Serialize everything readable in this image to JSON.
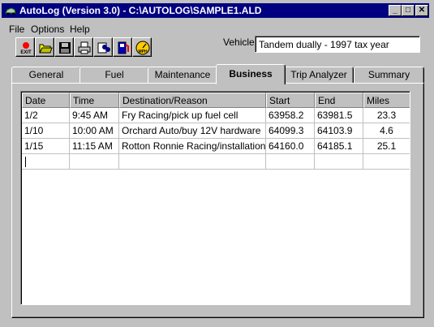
{
  "window": {
    "title": "AutoLog (Version 3.0) - C:\\AUTOLOG\\SAMPLE1.ALD",
    "minimize": "_",
    "maximize": "□",
    "close": "✕"
  },
  "menu": {
    "file": "File",
    "options": "Options",
    "help": "Help"
  },
  "toolbar": {
    "icons": [
      "exit-icon",
      "open-folder-icon",
      "save-disk-icon",
      "print-icon",
      "search-binoculars-icon",
      "fuel-pump-icon",
      "speedometer-mph-icon"
    ],
    "exit_label": "EXIT",
    "mph_label": "MPH"
  },
  "vehicle": {
    "label": "Vehicle",
    "value": "Tandem dually - 1997 tax year"
  },
  "tabs": [
    "General",
    "Fuel",
    "Maintenance",
    "Business",
    "Trip Analyzer",
    "Summary"
  ],
  "active_tab": "Business",
  "table": {
    "headers": [
      "Date",
      "Time",
      "Destination/Reason",
      "Start",
      "End",
      "Miles"
    ],
    "rows": [
      [
        "1/2",
        "9:45 AM",
        "Fry Racing/pick up fuel cell",
        "63958.2",
        "63981.5",
        "23.3"
      ],
      [
        "1/10",
        "10:00 AM",
        "Orchard Auto/buy 12V hardware",
        "64099.3",
        "64103.9",
        "4.6"
      ],
      [
        "1/15",
        "11:15 AM",
        "Rotton Ronnie Racing/installation",
        "64160.0",
        "64185.1",
        "25.1"
      ]
    ]
  }
}
